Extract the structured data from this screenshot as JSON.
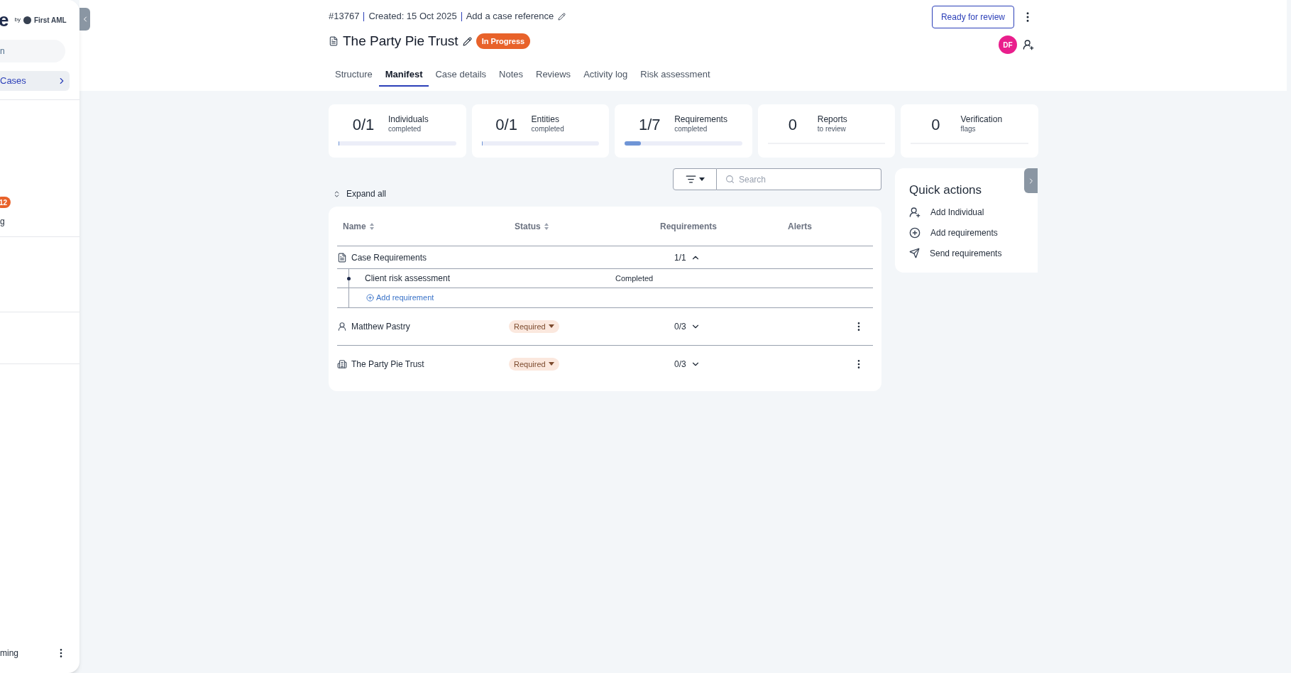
{
  "sidebar": {
    "logo": "e",
    "logo_by": "by",
    "logo_brand": "First AML",
    "search_placeholder": "n",
    "items": [
      {
        "label": "Cases",
        "selected": true
      }
    ],
    "badge": "12",
    "cut_item": "g",
    "user": "ming"
  },
  "header": {
    "case_number": "#13767",
    "created": "Created: 15 Oct 2025",
    "reference_link": "Add a case reference",
    "title": "The Party Pie Trust",
    "status": "In Progress",
    "review_button": "Ready for review",
    "avatar": "DF",
    "tabs": [
      {
        "label": "Structure",
        "selected": false
      },
      {
        "label": "Manifest",
        "selected": true
      },
      {
        "label": "Case details",
        "selected": false
      },
      {
        "label": "Notes",
        "selected": false
      },
      {
        "label": "Reviews",
        "selected": false
      },
      {
        "label": "Activity log",
        "selected": false
      },
      {
        "label": "Risk assessment",
        "selected": false
      }
    ]
  },
  "stats": [
    {
      "kind": "progress",
      "value": "0/1",
      "label": "Individuals",
      "sublabel": "completed",
      "level": 0
    },
    {
      "kind": "progress",
      "value": "0/1",
      "label": "Entities",
      "sublabel": "completed",
      "level": 0
    },
    {
      "kind": "progress",
      "value": "1/7",
      "label": "Requirements",
      "sublabel": "completed",
      "level": 0.14
    },
    {
      "kind": "plain",
      "value": "0",
      "label": "Reports",
      "sublabel": "to review"
    },
    {
      "kind": "plain",
      "value": "0",
      "label": "Verification",
      "sublabel": "flags"
    }
  ],
  "toolbar": {
    "expand_all": "Expand all",
    "search_placeholder": "Search"
  },
  "table": {
    "columns": [
      {
        "label": "Name",
        "sortable": true
      },
      {
        "label": "Status",
        "sortable": true
      },
      {
        "label": "Requirements",
        "sortable": false
      },
      {
        "label": "Alerts",
        "sortable": false
      }
    ],
    "rows": [
      {
        "kind": "case",
        "name": "Case Requirements",
        "requirements": "1/1",
        "expanded": true,
        "children": [
          {
            "name": "Client risk assessment",
            "status": "Completed"
          }
        ],
        "add_link": "Add requirement"
      },
      {
        "kind": "individual",
        "name": "Matthew Pastry",
        "status": "Required",
        "requirements": "0/3",
        "expanded": false
      },
      {
        "kind": "entity",
        "name": "The Party Pie Trust",
        "status": "Required",
        "requirements": "0/3",
        "expanded": false
      }
    ]
  },
  "quick_actions": {
    "title": "Quick actions",
    "items": [
      {
        "kind": "individual",
        "label": "Add Individual"
      },
      {
        "kind": "requirements",
        "label": "Add requirements"
      },
      {
        "kind": "send",
        "label": "Send requirements"
      }
    ]
  }
}
